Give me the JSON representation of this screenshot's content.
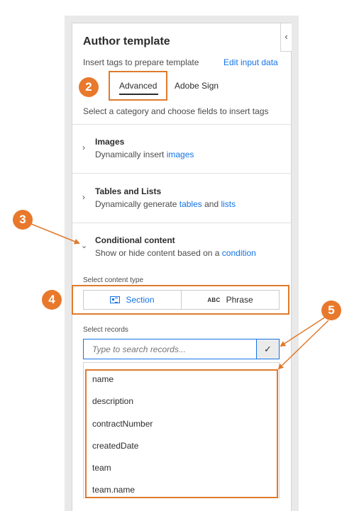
{
  "panel": {
    "title": "Author template",
    "subtitle": "Insert tags to prepare template",
    "edit_link": "Edit input data",
    "collapse_glyph": "‹"
  },
  "tabs": [
    {
      "label": "Advanced",
      "selected": true
    },
    {
      "label": "Adobe Sign",
      "selected": false
    }
  ],
  "instruction": "Select a category and choose fields to insert tags",
  "categories": [
    {
      "title": "Images",
      "desc_prefix": "Dynamically insert ",
      "desc_link1": "images",
      "expanded": false
    },
    {
      "title": "Tables and Lists",
      "desc_prefix": "Dynamically generate ",
      "desc_link1": "tables",
      "desc_mid": " and ",
      "desc_link2": "lists",
      "expanded": false
    },
    {
      "title": "Conditional content",
      "desc_prefix": "Show or hide content based on a ",
      "desc_link1": "condition",
      "expanded": true
    }
  ],
  "content_type": {
    "label": "Select content type",
    "options": [
      {
        "label": "Section",
        "icon": "section-icon",
        "selected": true
      },
      {
        "label": "Phrase",
        "icon": "abc-icon",
        "icon_text": "ABC",
        "selected": false
      }
    ]
  },
  "records": {
    "label": "Select records",
    "placeholder": "Type to search records...",
    "dropdown_glyph": "✓",
    "items": [
      "name",
      "description",
      "contractNumber",
      "createdDate",
      "team",
      "team.name"
    ]
  },
  "callouts": [
    "2",
    "3",
    "4",
    "5"
  ],
  "colors": {
    "accent": "#1473e6",
    "callout": "#e8792c"
  }
}
